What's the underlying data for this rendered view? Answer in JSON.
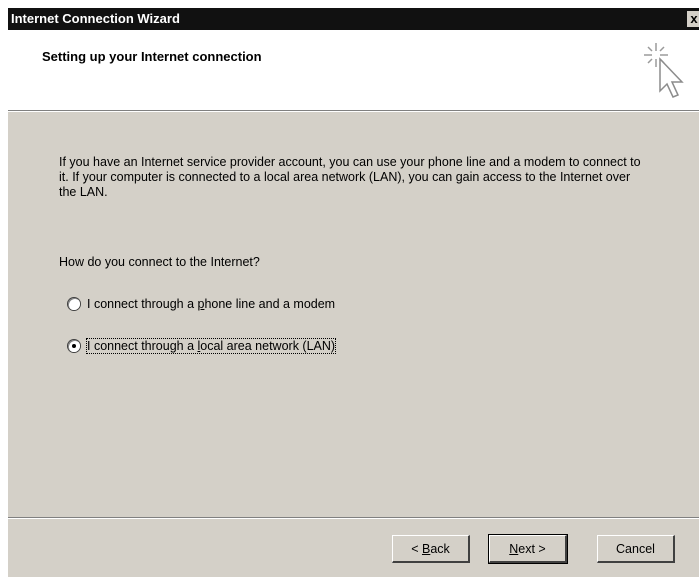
{
  "window": {
    "title": "Internet Connection Wizard",
    "close_glyph": "x"
  },
  "header": {
    "heading": "Setting up your Internet connection",
    "icon": "wizard-cursor-sparkle-icon"
  },
  "content": {
    "intro": "If you have an Internet service provider account, you can use your phone line and a modem to connect to it. If your computer is connected to a local area network (LAN), you can gain access to the Internet over the LAN.",
    "question": "How do you connect to the Internet?",
    "options": [
      {
        "pre": "I connect through a ",
        "accel": "p",
        "post": "hone line and a modem",
        "checked": false
      },
      {
        "pre": "I connect through a ",
        "accel": "l",
        "post": "ocal area network (LAN)",
        "checked": true
      }
    ]
  },
  "footer": {
    "back": {
      "pre": "< ",
      "accel": "B",
      "post": "ack"
    },
    "next": {
      "pre": "",
      "accel": "N",
      "post": "ext >"
    },
    "cancel": "Cancel"
  }
}
